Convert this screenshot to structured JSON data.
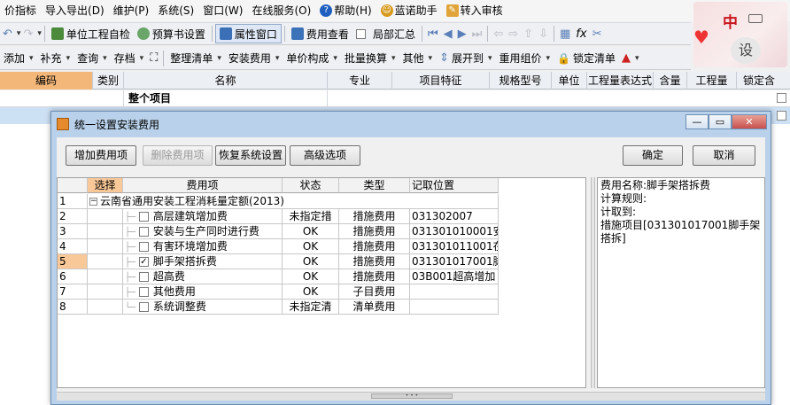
{
  "menubar": {
    "items": [
      "价指标",
      "导入导出(D)",
      "维护(P)",
      "系统(S)",
      "窗口(W)",
      "在线服务(O)",
      "帮助(H)",
      "蓝诺助手",
      "转入审核"
    ]
  },
  "toolbar1": {
    "unit_check": "单位工程自检",
    "budget_settings": "预算书设置",
    "property_window": "属性窗口",
    "fee_view": "费用查看",
    "partial_summary": "局部汇总"
  },
  "toolbar2": {
    "add": "添加",
    "supplement": "补充",
    "query": "查询",
    "store": "存档",
    "tidy_list": "整理清单",
    "install_fee": "安装费用",
    "unit_price_composition": "单价构成",
    "batch_convert": "批量换算",
    "other": "其他",
    "expand_to": "展开到",
    "reuse_group_price": "重用组价",
    "lock_list": "锁定清单"
  },
  "ime": {
    "lang": "中",
    "settings": "设"
  },
  "main_table": {
    "headers": [
      "编码",
      "类别",
      "名称",
      "专业",
      "项目特征",
      "规格型号",
      "单位",
      "工程量表达式",
      "含量",
      "工程量",
      "锁定含"
    ],
    "row1_name": "整个项目"
  },
  "dialog": {
    "title": "统一设置安装费用",
    "buttons": {
      "add_fee_item": "增加费用项",
      "delete_fee_item": "删除费用项",
      "restore_system": "恢复系统设置",
      "advanced": "高级选项",
      "ok": "确定",
      "cancel": "取消"
    },
    "grid": {
      "headers": [
        "选择",
        "费用项",
        "状态",
        "类型",
        "记取位置"
      ],
      "group_label": "云南省通用安装工程消耗量定额(2013)",
      "rows": [
        {
          "num": "2",
          "name": "高层建筑增加费",
          "status": "未指定措",
          "type": "措施费用",
          "pos": "031302007",
          "checked": false
        },
        {
          "num": "3",
          "name": "安装与生产同时进行费",
          "status": "OK",
          "type": "措施费用",
          "pos": "031301010001安",
          "checked": false
        },
        {
          "num": "4",
          "name": "有害环境增加费",
          "status": "OK",
          "type": "措施费用",
          "pos": "031301011001在",
          "checked": false
        },
        {
          "num": "5",
          "name": "脚手架搭拆费",
          "status": "OK",
          "type": "措施费用",
          "pos": "031301017001脚",
          "checked": true
        },
        {
          "num": "6",
          "name": "超高费",
          "status": "OK",
          "type": "措施费用",
          "pos": "03B001超高增加",
          "checked": false
        },
        {
          "num": "7",
          "name": "其他费用",
          "status": "OK",
          "type": "子目费用",
          "pos": "",
          "checked": false
        },
        {
          "num": "8",
          "name": "系统调整费",
          "status": "未指定清",
          "type": "清单费用",
          "pos": "",
          "checked": false
        }
      ]
    },
    "info": {
      "fee_name": "费用名称:脚手架搭拆费",
      "calc_rule": "计算规则:",
      "charge_to": "计取到:",
      "measure_item": "措施项目[031301017001脚手架搭拆]"
    }
  },
  "colors": {
    "dialog_frame": "#b9d1ea",
    "selected_row": "#cde1f5",
    "highlight_cell": "#f8c898"
  }
}
